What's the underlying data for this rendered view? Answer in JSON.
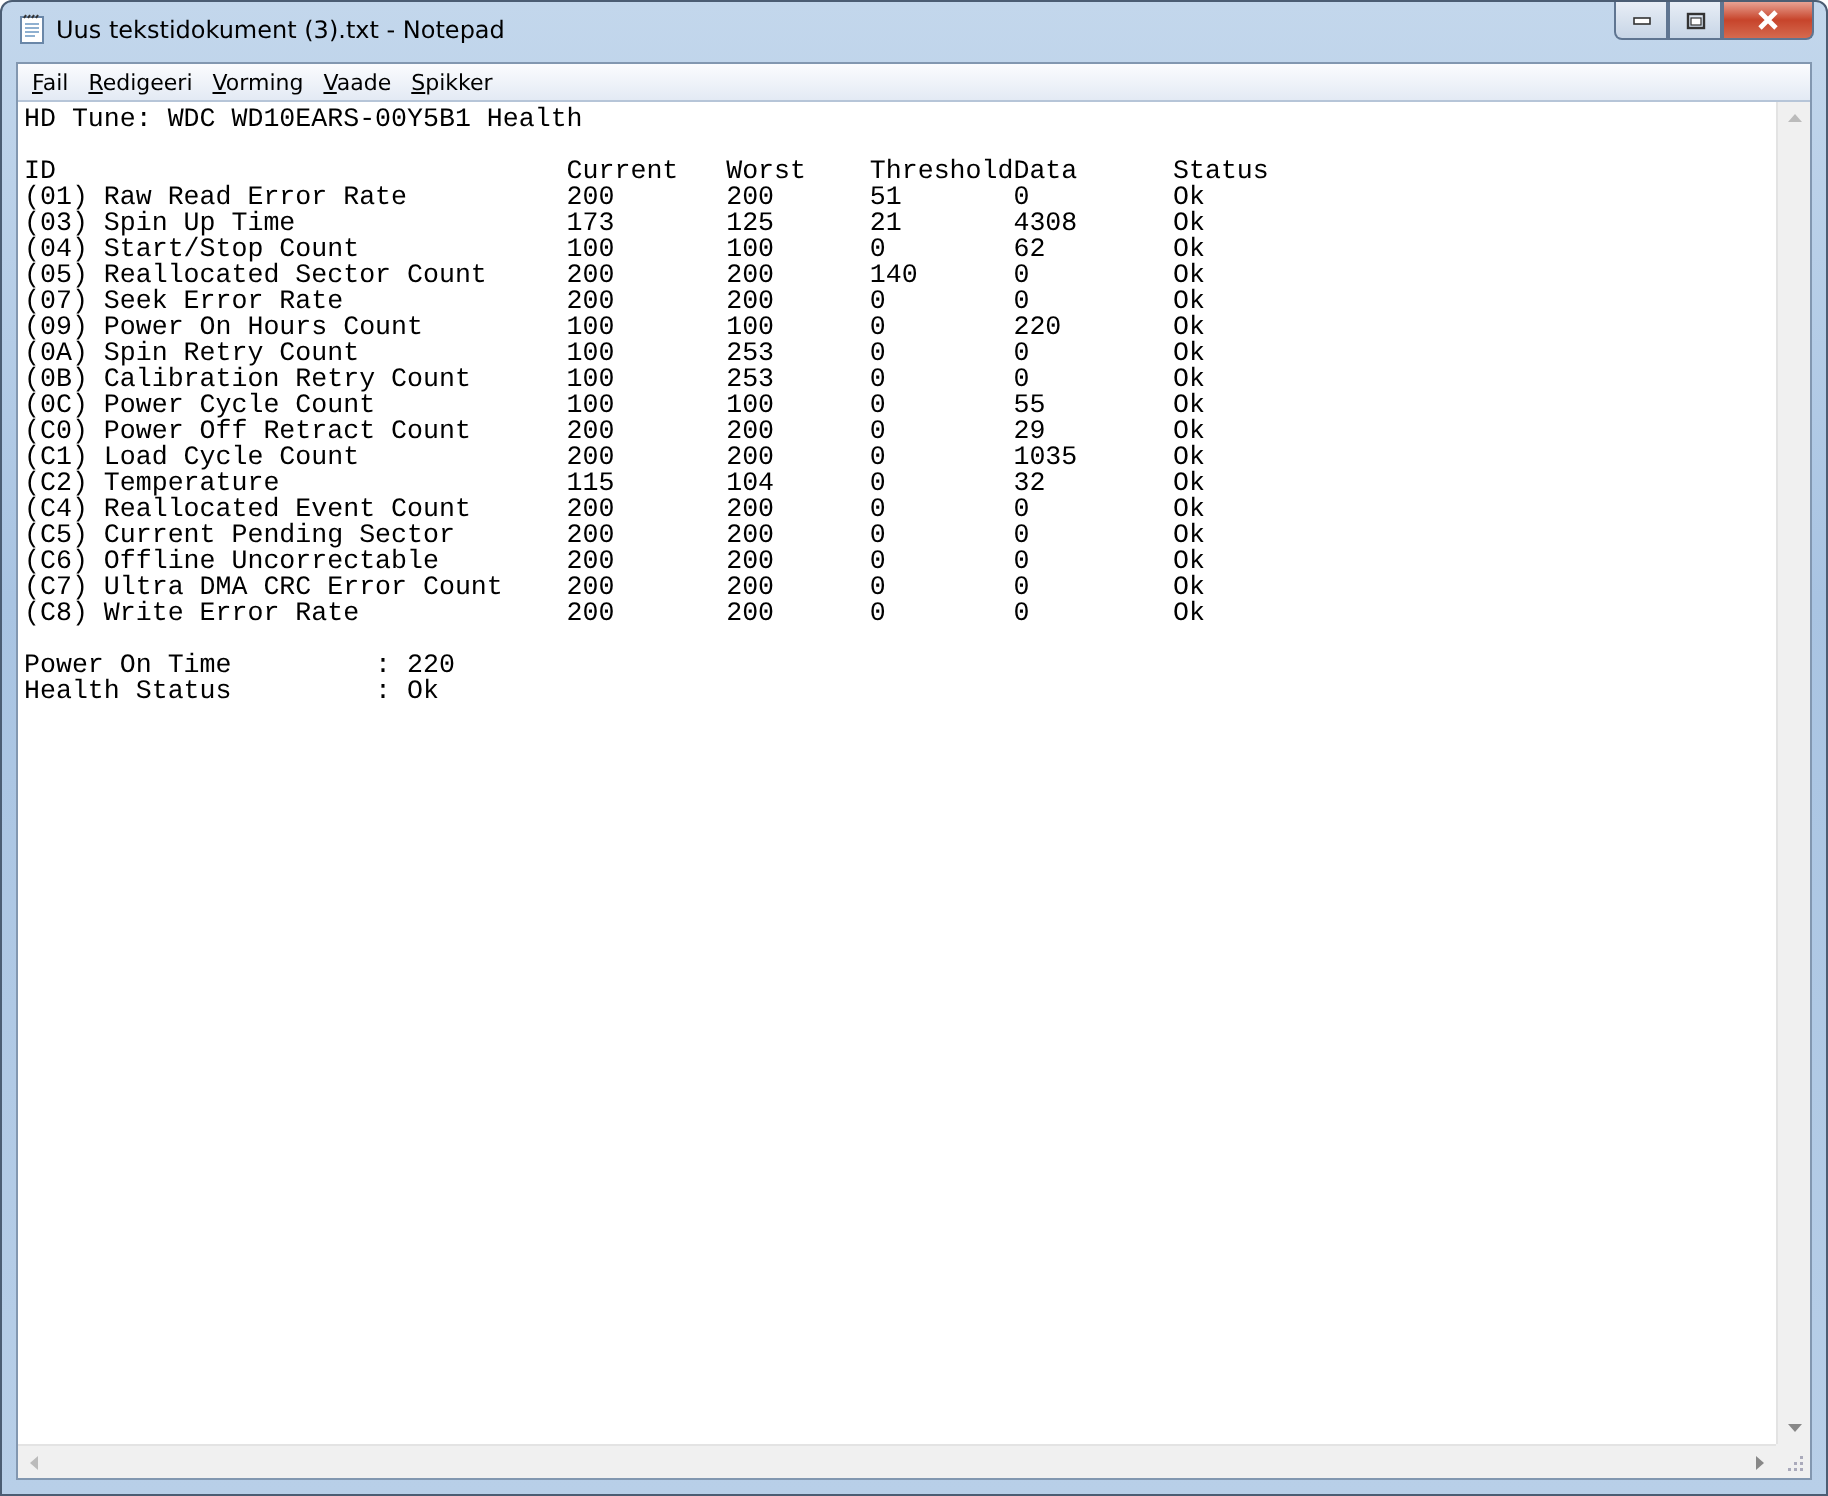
{
  "window": {
    "title": "Uus tekstidokument (3).txt - Notepad"
  },
  "menu": [
    "Fail",
    "Redigeeri",
    "Vorming",
    "Vaade",
    "Spikker"
  ],
  "document": {
    "heading": "HD Tune: WDC WD10EARS-00Y5B1 Health",
    "table_lines": [
      "ID                                Current   Worst    ThresholdData      Status",
      "(01) Raw Read Error Rate          200       200      51       0         Ok",
      "(03) Spin Up Time                 173       125      21       4308      Ok",
      "(04) Start/Stop Count             100       100      0        62        Ok",
      "(05) Reallocated Sector Count     200       200      140      0         Ok",
      "(07) Seek Error Rate              200       200      0        0         Ok",
      "(09) Power On Hours Count         100       100      0        220       Ok",
      "(0A) Spin Retry Count             100       253      0        0         Ok",
      "(0B) Calibration Retry Count      100       253      0        0         Ok",
      "(0C) Power Cycle Count            100       100      0        55        Ok",
      "(C0) Power Off Retract Count      200       200      0        29        Ok",
      "(C1) Load Cycle Count             200       200      0        1035      Ok",
      "(C2) Temperature                  115       104      0        32        Ok",
      "(C4) Reallocated Event Count      200       200      0        0         Ok",
      "(C5) Current Pending Sector       200       200      0        0         Ok",
      "(C6) Offline Uncorrectable        200       200      0        0         Ok",
      "(C7) Ultra DMA CRC Error Count    200       200      0        0         Ok",
      "(C8) Write Error Rate             200       200      0        0         Ok"
    ],
    "summary_lines": [
      "Power On Time         : 220",
      "Health Status         : Ok"
    ]
  }
}
